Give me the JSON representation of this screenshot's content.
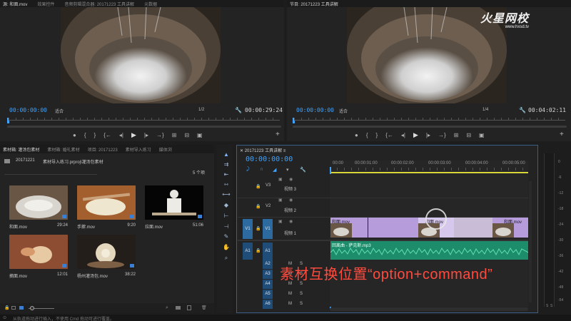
{
  "source_monitor": {
    "tabs": [
      "源: 和面.mov",
      "效果控件",
      "音频剪辑混合器: 20171223 工具讲解",
      "元数据"
    ],
    "timecode": "00:00:00:00",
    "fit": "适合",
    "quality": "1/2",
    "duration": "00:00:29:24"
  },
  "program_monitor": {
    "tab": "节目: 20171223 工具讲解",
    "timecode": "00:00:00:00",
    "fit": "适合",
    "quality": "1/4",
    "duration": "00:04:02:11"
  },
  "watermark": {
    "brand": "火星网校",
    "url": "www.hxsd.tv"
  },
  "transport": {
    "marker": "●",
    "in": "{",
    "out": "}",
    "go_in": "{←",
    "step_back": "◂|",
    "play": "▶",
    "step_fwd": "|▸",
    "go_out": "→}",
    "insert": "⊞",
    "overwrite": "⊟",
    "export_frame": "▣",
    "add": "+"
  },
  "project_panel": {
    "tabs": [
      "素材箱: 灌汤包素材",
      "素材箱: 婚礼素材",
      "项目: 20171223",
      "素材导入练习",
      "媒体浏"
    ],
    "folder": "20171221",
    "path": "素材导入练习.prproj\\灌汤包素材",
    "count": "5 个项",
    "items": [
      {
        "name": "和面.mov",
        "duration": "29:24"
      },
      {
        "name": "手擀.mov",
        "duration": "9:20"
      },
      {
        "name": "拉面.mov",
        "duration": "51:06"
      },
      {
        "name": "摘面.mov",
        "duration": "12:01"
      },
      {
        "name": "杨州灌汤包.mov",
        "duration": "38:22"
      }
    ]
  },
  "status_bar": "从轨道拖动进行插入，不使用 Cmd 拖动可进行覆盖。",
  "timeline": {
    "tab": "20171223 工具讲解",
    "timecode": "00:00:00:00",
    "ruler": [
      "00:00",
      "00:00:01:00",
      "00:00:02:00",
      "00:00:03:00",
      "00:00:04:00",
      "00:00:05:00"
    ],
    "video_tracks": [
      {
        "id": "V3",
        "name": "视频 3"
      },
      {
        "id": "V2",
        "name": "视频 2"
      },
      {
        "id": "V1",
        "name": "视频 1",
        "source": "V1"
      }
    ],
    "audio_tracks": [
      {
        "id": "A1",
        "source": "A1"
      },
      {
        "id": "A2"
      },
      {
        "id": "A3"
      },
      {
        "id": "A4"
      },
      {
        "id": "A5"
      },
      {
        "id": "A6"
      }
    ],
    "track_toggles": {
      "mute": "M",
      "solo": "S"
    },
    "clips": [
      {
        "label": "和面.mov",
        "color": "#b79cdc"
      },
      {
        "label": "和面.mov",
        "color": "#b79cdc"
      },
      {
        "label": "和面.mov",
        "color": "#b79cdc"
      }
    ],
    "audio_clip_label": "回离曲 - 萨克斯.mp3"
  },
  "meter_labels": [
    "0",
    "-6",
    "-12",
    "-18",
    "-24",
    "-30",
    "-36",
    "-42",
    "-48",
    "-54"
  ],
  "meter_bottom": [
    "S",
    "S"
  ],
  "overlay_caption": "素材互换位置“option+command”"
}
